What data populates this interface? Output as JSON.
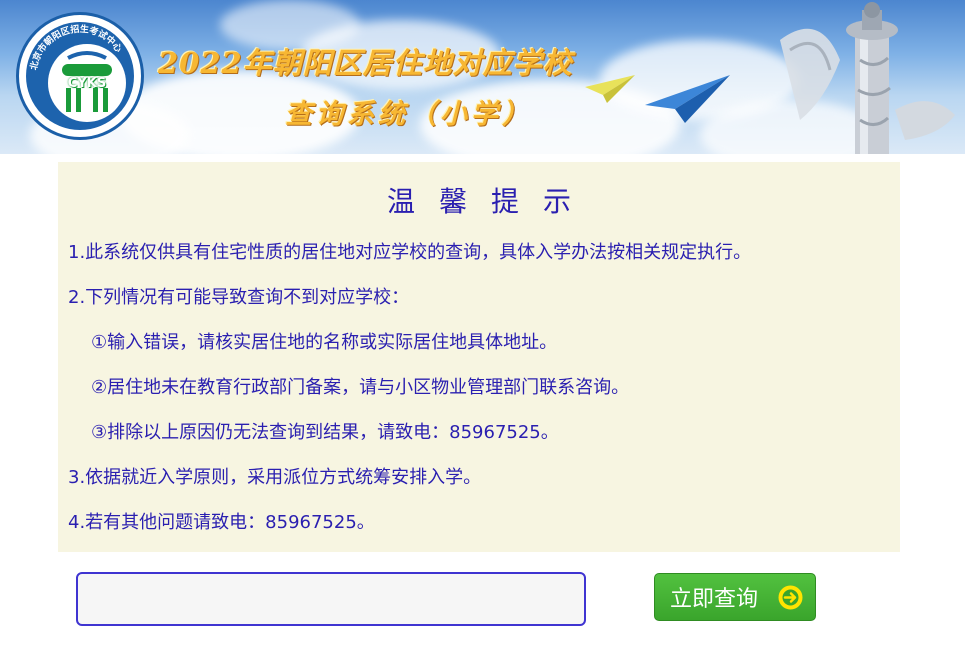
{
  "banner": {
    "title": "2022年朝阳区居住地对应学校",
    "subtitle": "查询系统（小学）",
    "logo_text": "CYKS",
    "logo_ring_text": "北京市朝阳区招生考试中心"
  },
  "notice": {
    "title": "温馨提示",
    "lines": [
      "1.此系统仅供具有住宅性质的居住地对应学校的查询，具体入学办法按相关规定执行。",
      "2.下列情况有可能导致查询不到对应学校：",
      "①输入错误，请核实居住地的名称或实际居住地具体地址。",
      "②居住地未在教育行政部门备案，请与小区物业管理部门联系咨询。",
      "③排除以上原因仍无法查询到结果，请致电：85967525。",
      "3.依据就近入学原则，采用派位方式统筹安排入学。",
      "4.若有其他问题请致电：85967525。"
    ]
  },
  "search": {
    "value": "",
    "placeholder": "",
    "button_label": "立即查询"
  },
  "colors": {
    "notice_text": "#2a1fb0",
    "notice_bg": "#f7f5e1",
    "button_green": "#3aa52c",
    "title_gold": "#f7b733"
  }
}
